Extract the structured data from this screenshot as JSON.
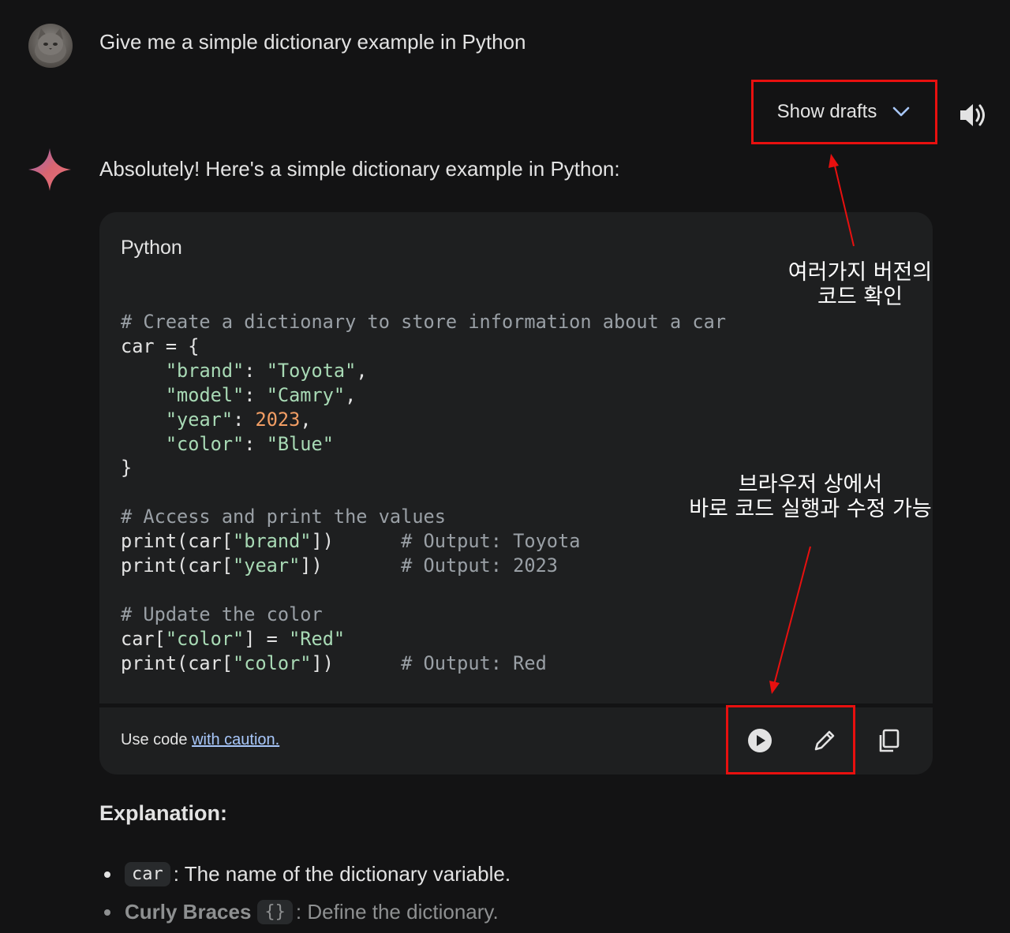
{
  "user_prompt": "Give me a simple dictionary example in Python",
  "drafts": {
    "label": "Show drafts",
    "icon": "chevron-down-icon"
  },
  "speaker": {
    "icon": "speaker-icon"
  },
  "answer": {
    "intro": "Absolutely! Here's a simple dictionary example in Python:"
  },
  "code_block": {
    "language": "Python",
    "code": "# Create a dictionary to store information about a car\ncar = {\n    \"brand\": \"Toyota\",\n    \"model\": \"Camry\",\n    \"year\": 2023,\n    \"color\": \"Blue\"\n}\n\n# Access and print the values\nprint(car[\"brand\"])      # Output: Toyota\nprint(car[\"year\"])       # Output: 2023\n\n# Update the color\ncar[\"color\"] = \"Red\"\nprint(car[\"color\"])      # Output: Red",
    "footer": {
      "text": "Use code ",
      "link": "with caution."
    },
    "actions": [
      "run-icon",
      "edit-icon",
      "copy-icon"
    ]
  },
  "annotations": {
    "drafts_note": "여러가지 버전의\n코드 확인",
    "run_edit_note": "브라우저 상에서\n바로 코드 실행과 수정 가능"
  },
  "explanation": {
    "heading": "Explanation:",
    "items": [
      {
        "code": "car",
        "term": "",
        "text": ": The name of the dictionary variable."
      },
      {
        "code": "{}",
        "term": "Curly Braces",
        "text": ": Define the dictionary."
      }
    ]
  },
  "colors": {
    "background": "#131314",
    "code_background": "#1e1f20",
    "comment": "#9aa0a6",
    "string": "#a8dab5",
    "number": "#f29e64",
    "link": "#a8c7fa",
    "annotation_box": "#e8100f"
  }
}
